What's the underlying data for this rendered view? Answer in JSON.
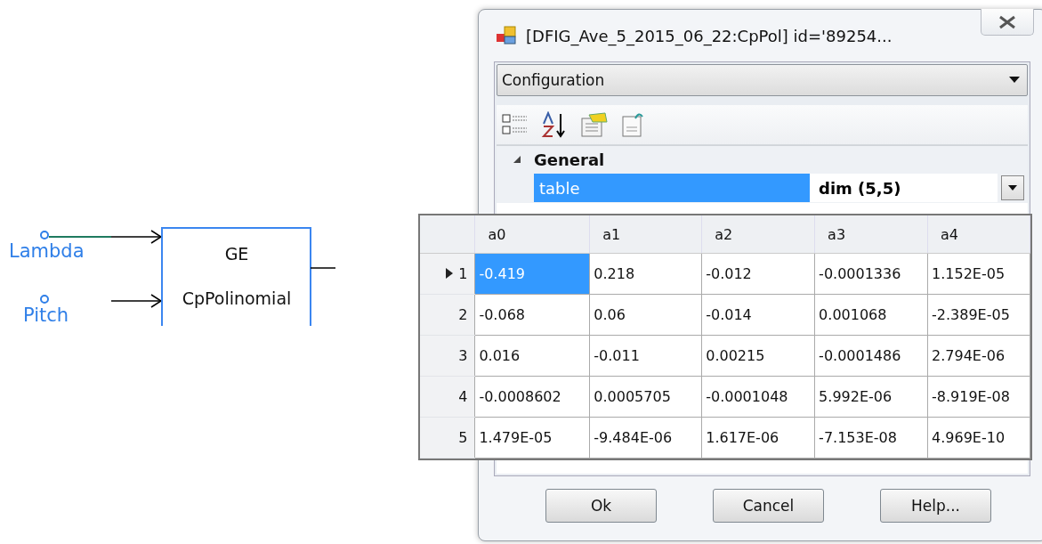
{
  "diagram": {
    "inputs": [
      {
        "label": "Lambda",
        "wired": true
      },
      {
        "label": "Pitch",
        "wired": false
      }
    ],
    "block": {
      "lines": [
        "GE",
        "CpPolinomial"
      ]
    }
  },
  "dialog": {
    "title": "[DFIG_Ave_5_2015_06_22:CpPol] id='89254...",
    "category": "Configuration",
    "property_grid": {
      "group": {
        "label": "General",
        "expanded": true
      },
      "property": {
        "name": "table",
        "value": "dim (5,5)",
        "selected": true
      }
    },
    "table_editor": {
      "columns": [
        "a0",
        "a1",
        "a2",
        "a3",
        "a4"
      ],
      "rows": [
        {
          "label": "1",
          "current": true,
          "cells": [
            {
              "text": "-0.419",
              "selected": true
            },
            {
              "text": "0.218",
              "selected": false
            },
            {
              "text": "-0.012",
              "selected": false
            },
            {
              "text": "-0.0001336",
              "selected": false
            },
            {
              "text": "1.152E-05",
              "selected": false
            }
          ]
        },
        {
          "label": "2",
          "current": false,
          "cells": [
            {
              "text": "-0.068",
              "selected": false
            },
            {
              "text": "0.06",
              "selected": false
            },
            {
              "text": "-0.014",
              "selected": false
            },
            {
              "text": "0.001068",
              "selected": false
            },
            {
              "text": "-2.389E-05",
              "selected": false
            }
          ]
        },
        {
          "label": "3",
          "current": false,
          "cells": [
            {
              "text": "0.016",
              "selected": false
            },
            {
              "text": "-0.011",
              "selected": false
            },
            {
              "text": "0.00215",
              "selected": false
            },
            {
              "text": "-0.0001486",
              "selected": false
            },
            {
              "text": "2.794E-06",
              "selected": false
            }
          ]
        },
        {
          "label": "4",
          "current": false,
          "cells": [
            {
              "text": "-0.0008602",
              "selected": false
            },
            {
              "text": "0.0005705",
              "selected": false
            },
            {
              "text": "-0.0001048",
              "selected": false
            },
            {
              "text": "5.992E-06",
              "selected": false
            },
            {
              "text": "-8.919E-08",
              "selected": false
            }
          ]
        },
        {
          "label": "5",
          "current": false,
          "cells": [
            {
              "text": "1.479E-05",
              "selected": false
            },
            {
              "text": "-9.484E-06",
              "selected": false
            },
            {
              "text": "1.617E-06",
              "selected": false
            },
            {
              "text": "-7.153E-08",
              "selected": false
            },
            {
              "text": "4.969E-10",
              "selected": false
            }
          ]
        }
      ]
    },
    "buttons": [
      "Ok",
      "Cancel",
      "Help..."
    ]
  }
}
